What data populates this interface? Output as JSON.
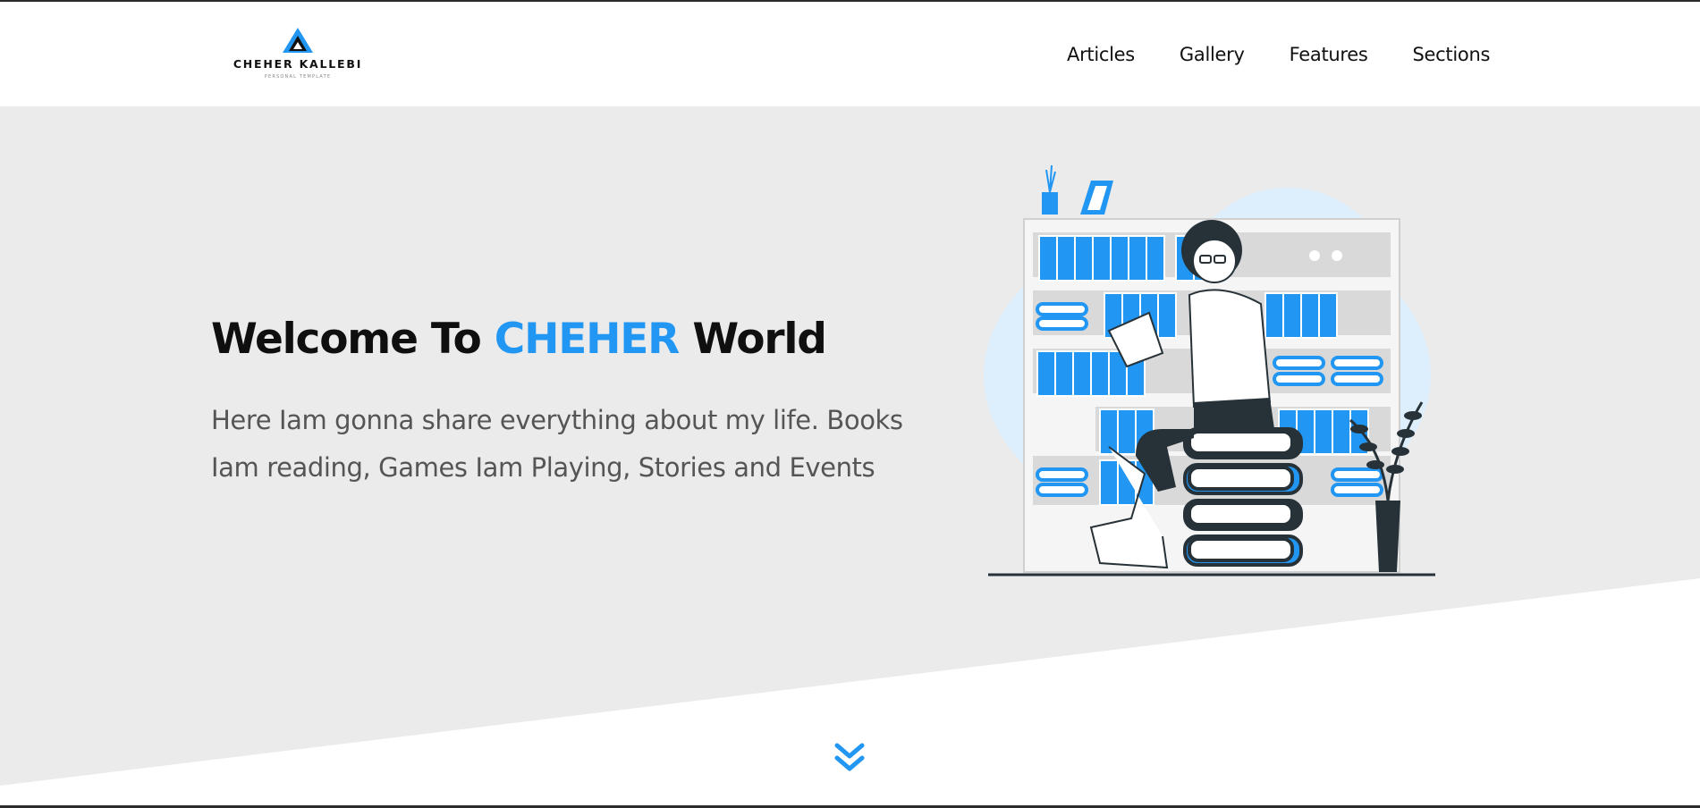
{
  "brand": {
    "name": "CHEHER KALLEBI",
    "tagline": "PERSONAL TEMPLATE",
    "logo_icon": "triangle-logo-icon"
  },
  "nav": {
    "items": [
      {
        "label": "Articles"
      },
      {
        "label": "Gallery"
      },
      {
        "label": "Features"
      },
      {
        "label": "Sections"
      }
    ]
  },
  "hero": {
    "title_before": "Welcome To ",
    "title_accent": "CHEHER",
    "title_after": " World",
    "subtitle": "Here Iam gonna share everything about my life. Books Iam reading, Games Iam Playing, Stories and Events",
    "illustration_icon": "reading-person-bookshelf-illustration",
    "scroll_icon": "double-chevron-down-icon"
  },
  "colors": {
    "accent": "#2196f3",
    "hero_bg": "#ebebeb",
    "text_dark": "#0f0f0f",
    "text_muted": "#555555"
  }
}
